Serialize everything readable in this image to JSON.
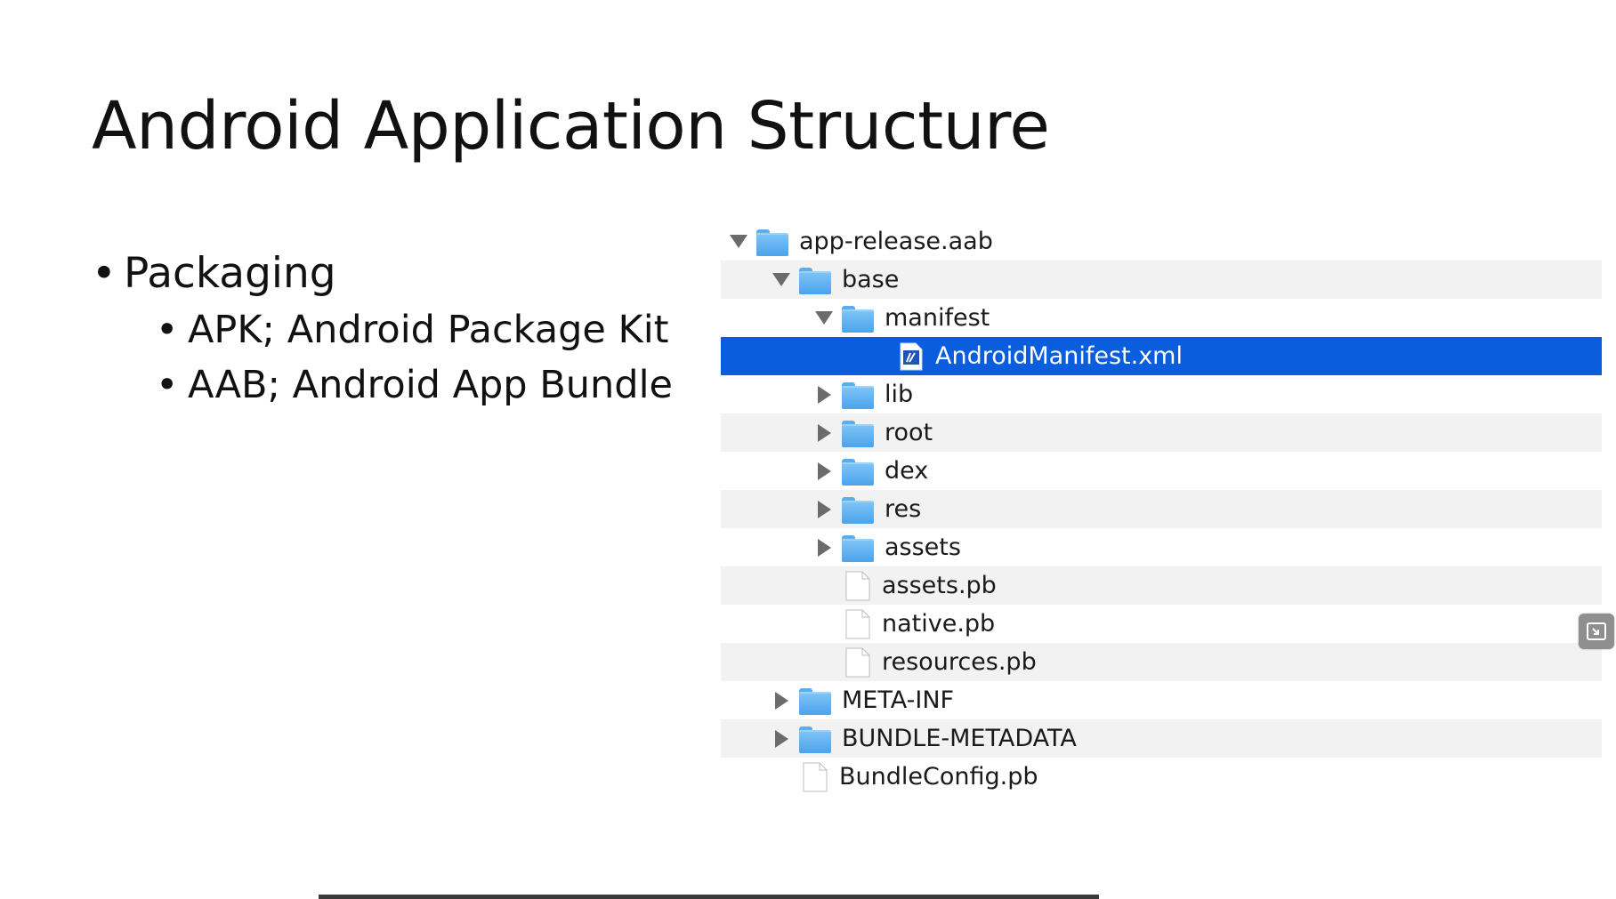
{
  "slide": {
    "title": "Android Application Structure",
    "bullets": {
      "main": "Packaging",
      "sub": [
        "APK; Android Package Kit",
        "AAB; Android App Bundle"
      ]
    }
  },
  "tree": {
    "rows": [
      {
        "label": "app-release.aab",
        "type": "folder",
        "expanded": true
      },
      {
        "label": "base",
        "type": "folder",
        "expanded": true
      },
      {
        "label": "manifest",
        "type": "folder",
        "expanded": true
      },
      {
        "label": "AndroidManifest.xml",
        "type": "xml-file",
        "selected": true
      },
      {
        "label": "lib",
        "type": "folder",
        "expanded": false
      },
      {
        "label": "root",
        "type": "folder",
        "expanded": false
      },
      {
        "label": "dex",
        "type": "folder",
        "expanded": false
      },
      {
        "label": "res",
        "type": "folder",
        "expanded": false
      },
      {
        "label": "assets",
        "type": "folder",
        "expanded": false
      },
      {
        "label": "assets.pb",
        "type": "file"
      },
      {
        "label": "native.pb",
        "type": "file"
      },
      {
        "label": "resources.pb",
        "type": "file"
      },
      {
        "label": "META-INF",
        "type": "folder",
        "expanded": false
      },
      {
        "label": "BUNDLE-METADATA",
        "type": "folder",
        "expanded": false
      },
      {
        "label": "BundleConfig.pb",
        "type": "file"
      }
    ]
  },
  "colors": {
    "selection": "#0a5ddd",
    "folder": "#5aaef0",
    "alt_row": "#f2f2f2"
  },
  "icons": {
    "side_button": "exit-fullscreen-icon"
  }
}
